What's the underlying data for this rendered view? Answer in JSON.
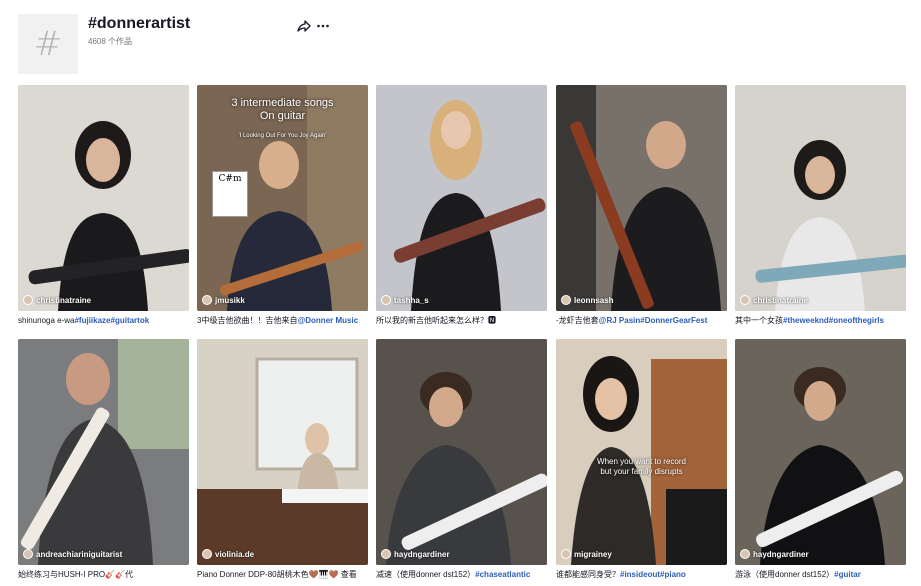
{
  "header": {
    "title": "#donnerartist",
    "count": "4608 个作品",
    "hash_symbol": "#"
  },
  "videos": [
    {
      "user": "christinatraine",
      "caption_text": "shinunoga e-wa",
      "tags": "#fujiikaze#guitartok",
      "bg": "#d8d4cf"
    },
    {
      "user": "jmusikk",
      "caption_text": "3中级吉他欲曲！！吉他来自",
      "tags": "@Donner Music",
      "bg": "#6b5a4a",
      "overlay_title": "3 intermediate songs\nOn guitar",
      "overlay_sub": "'I Looking Out For You  Joy Again'",
      "chord": "C#m"
    },
    {
      "user": "tashha_s",
      "caption_text": "所以我的新吉他听起来怎么样？🅽",
      "tags": "",
      "bg": "#b7b9c0"
    },
    {
      "user": "leonnsash",
      "caption_text": "-龙虾吉他套",
      "tags": "@RJ Pasin#DonnerGearFest",
      "bg": "#6a6560"
    },
    {
      "user": "christinatraine",
      "caption_text": "其中一个女孩",
      "tags": "#theweeknd#oneofthegirls",
      "bg": "#cfcbc5"
    },
    {
      "user": "andreachiariniguitarist",
      "caption_text": "始终练习与HUSH-I PRO🎸🎸代",
      "tags": "",
      "bg": "#6f6f6f"
    },
    {
      "user": "violinia.de",
      "caption_text": "Piano Donner DDP-80胡桃木色🤎🎹🤎 查看",
      "tags": "",
      "bg": "#cfc8bd"
    },
    {
      "user": "haydngardiner",
      "caption_text": "减速（使用donner dst152）",
      "tags": "#chaseatlantic",
      "bg": "#4d4a44"
    },
    {
      "user": "migrainey",
      "caption_text": "谁都能感同身受？",
      "tags": "#insideout#piano",
      "bg": "#d3c7b8",
      "overlay_text": "When you want to record\nbut your family disrupts"
    },
    {
      "user": "haydngardiner",
      "caption_text": "游泳（使用donner dst152）",
      "tags": "#guitar",
      "bg": "#5c574f"
    }
  ],
  "colors": {
    "hashtag": "#2b5db9",
    "text": "#161823",
    "muted": "#757575"
  },
  "icons": {
    "share": "share-icon",
    "more": "more-icon"
  }
}
